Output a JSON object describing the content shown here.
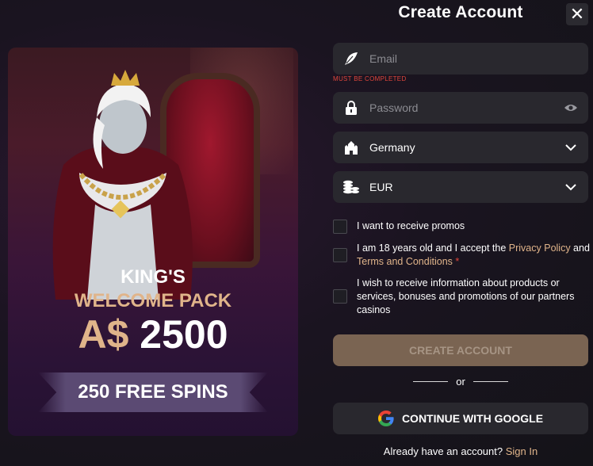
{
  "header": {
    "title": "Create Account",
    "close_label": "✕"
  },
  "promo": {
    "line1": "KING'S",
    "line2": "WELCOME PACK",
    "currency": "A$",
    "amount": "2500",
    "spins": "250 FREE SPINS"
  },
  "form": {
    "email": {
      "placeholder": "Email",
      "error": "MUST BE COMPLETED",
      "icon": "feather-icon"
    },
    "password": {
      "placeholder": "Password",
      "icon": "lock-icon",
      "toggle_icon": "eye-icon"
    },
    "country": {
      "value": "Germany",
      "icon": "castle-icon"
    },
    "currency": {
      "value": "EUR",
      "icon": "coins-icon"
    },
    "checkboxes": {
      "promos": "I want to receive promos",
      "age_prefix": "I am 18 years old and I accept the ",
      "privacy": "Privacy Policy",
      "and": " and ",
      "terms": "Terms and Conditions",
      "required_mark": " *",
      "partners": "I wish to receive information about products or services, bonuses and promotions of our partners casinos"
    },
    "create_button": "CREATE ACCOUNT",
    "or": "or",
    "google_button": "CONTINUE WITH GOOGLE",
    "already_text": "Already have an account?",
    "sign_in": "Sign In"
  },
  "colors": {
    "accent": "#e0b48a",
    "error": "#e0463c",
    "field_bg": "#29282e",
    "button_disabled": "#7a6452"
  }
}
